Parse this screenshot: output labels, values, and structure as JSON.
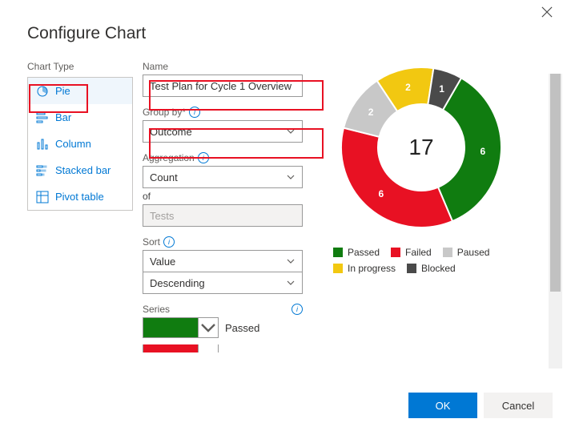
{
  "dialog": {
    "title": "Configure Chart"
  },
  "chart_type": {
    "label": "Chart Type",
    "items": {
      "pie": "Pie",
      "bar": "Bar",
      "column": "Column",
      "stacked_bar": "Stacked bar",
      "pivot_table": "Pivot table"
    }
  },
  "form": {
    "name_label": "Name",
    "name_value": "Test Plan for Cycle 1 Overview",
    "groupby_label": "Group by*",
    "groupby_value": "Outcome",
    "aggregation_label": "Aggregation",
    "aggregation_value": "Count",
    "of_word": "of",
    "of_value": "Tests",
    "sort_label": "Sort",
    "sort_value_primary": "Value",
    "sort_value_secondary": "Descending",
    "series_label": "Series",
    "series": {
      "0": {
        "name": "Passed",
        "color": "#107c10"
      }
    }
  },
  "chart_data": {
    "type": "pie",
    "title": "",
    "total": 17,
    "series": [
      {
        "name": "Passed",
        "value": 6,
        "color": "#107c10"
      },
      {
        "name": "Failed",
        "value": 6,
        "color": "#e81123"
      },
      {
        "name": "Paused",
        "value": 2,
        "color": "#c8c8c8"
      },
      {
        "name": "In progress",
        "value": 2,
        "color": "#f2c811"
      },
      {
        "name": "Blocked",
        "value": 1,
        "color": "#4a4a4a"
      }
    ]
  },
  "footer": {
    "ok": "OK",
    "cancel": "Cancel"
  },
  "colors": {
    "brand": "#0078d4"
  }
}
